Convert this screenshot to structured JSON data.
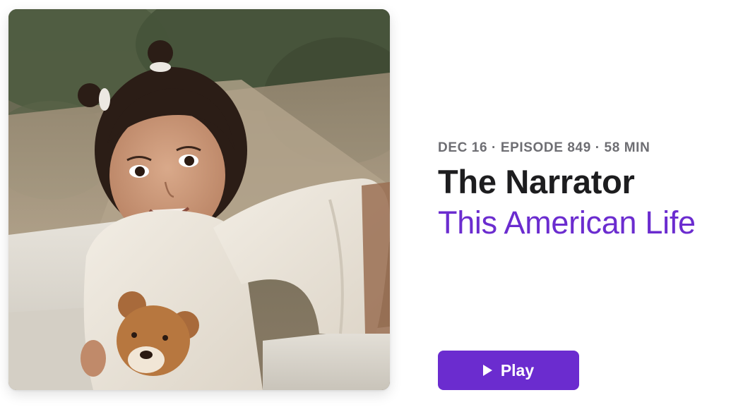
{
  "episode": {
    "date": "DEC 16",
    "episode_label": "EPISODE 849",
    "duration": "58 MIN",
    "meta_line": "DEC 16 · EPISODE 849 · 58 MIN",
    "title": "The Narrator",
    "show_name": "This American Life"
  },
  "artwork": {
    "description_icon": "episode-artwork-photo"
  },
  "actions": {
    "play_label": "Play",
    "play_icon": "play-icon"
  },
  "colors": {
    "accent": "#6b2ccf",
    "title": "#1d1d1f",
    "meta": "#6e6e73"
  }
}
